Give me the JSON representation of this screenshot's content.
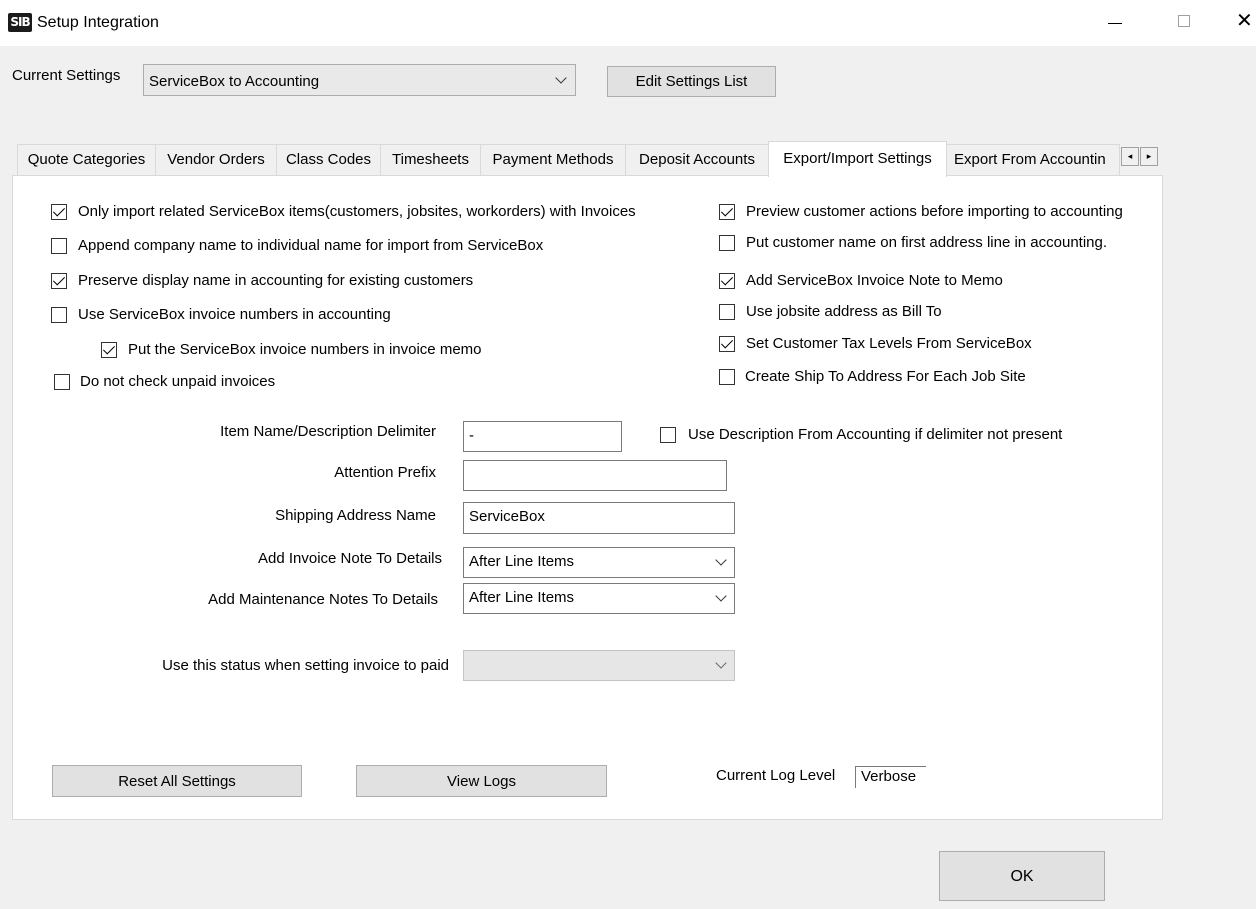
{
  "window": {
    "app_icon_text": "SIB",
    "title": "Setup Integration"
  },
  "settings": {
    "current_label": "Current Settings",
    "current_value": "ServiceBox to Accounting",
    "edit_button": "Edit Settings List"
  },
  "tabs": [
    {
      "label": "Quote Categories",
      "active": false
    },
    {
      "label": "Vendor Orders",
      "active": false
    },
    {
      "label": "Class Codes",
      "active": false
    },
    {
      "label": "Timesheets",
      "active": false
    },
    {
      "label": "Payment Methods",
      "active": false
    },
    {
      "label": "Deposit Accounts",
      "active": false
    },
    {
      "label": "Export/Import Settings",
      "active": true
    },
    {
      "label": "Export From Accountin",
      "active": false
    }
  ],
  "checkboxes_left": [
    {
      "label": "Only import related ServiceBox items(customers, jobsites, workorders) with Invoices",
      "checked": true
    },
    {
      "label": "Append company name to individual name for import from ServiceBox",
      "checked": false
    },
    {
      "label": "Preserve display name in accounting for existing customers",
      "checked": true
    },
    {
      "label": "Use ServiceBox invoice numbers in accounting",
      "checked": false
    },
    {
      "label": "Put the ServiceBox invoice numbers in invoice memo",
      "checked": true
    },
    {
      "label": "Do not check unpaid invoices",
      "checked": false
    }
  ],
  "checkboxes_right": [
    {
      "label": "Preview customer actions before importing to accounting",
      "checked": true
    },
    {
      "label": "Put customer name on first address line in accounting.",
      "checked": false
    },
    {
      "label": "Add ServiceBox Invoice Note to Memo",
      "checked": true
    },
    {
      "label": "Use jobsite address as Bill To",
      "checked": false
    },
    {
      "label": "Set Customer Tax Levels From ServiceBox",
      "checked": true
    },
    {
      "label": "Create Ship To Address For Each Job Site",
      "checked": false
    }
  ],
  "form": {
    "delimiter_label": "Item Name/Description Delimiter",
    "delimiter_value": "-",
    "use_description_label": "Use Description From Accounting if delimiter not present",
    "use_description_checked": false,
    "attention_label": "Attention Prefix",
    "attention_value": "",
    "shipping_label": "Shipping Address Name",
    "shipping_value": "ServiceBox",
    "invoice_note_label": "Add Invoice Note To Details",
    "invoice_note_value": "After Line Items",
    "maintenance_label": "Add Maintenance Notes To Details",
    "maintenance_value": "After Line Items",
    "paid_status_label": "Use this status when setting invoice to paid",
    "paid_status_value": ""
  },
  "bottom": {
    "reset_button": "Reset All Settings",
    "logs_button": "View Logs",
    "log_level_label": "Current Log Level",
    "log_level_value": "Verbose",
    "ok_button": "OK"
  },
  "icons": {
    "scroll_left": "◂",
    "scroll_right": "▸",
    "close": "✕"
  }
}
